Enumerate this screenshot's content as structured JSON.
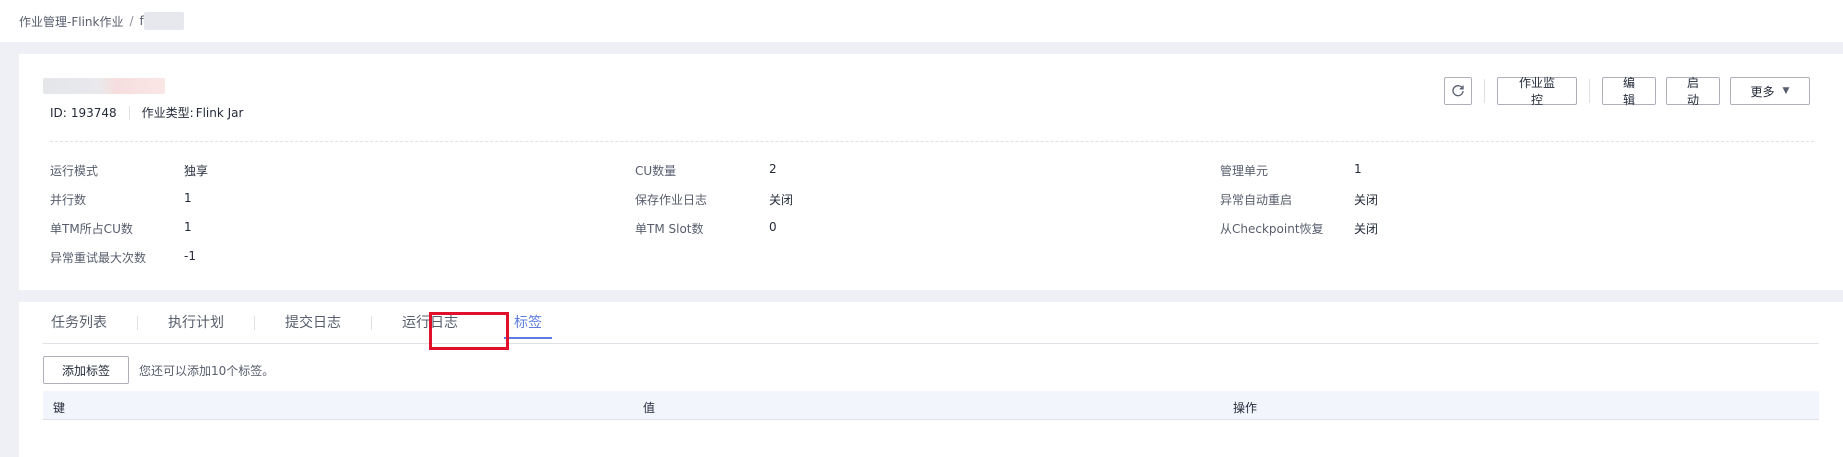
{
  "breadcrumb": {
    "parent": "作业管理-Flink作业",
    "separator": "/",
    "current": "f"
  },
  "job": {
    "id_label": "ID:",
    "id_value": "193748",
    "type_label": "作业类型:",
    "type_value": "Flink Jar"
  },
  "actions": {
    "refresh_icon": "refresh-icon",
    "monitor": "作业监控",
    "edit": "编辑",
    "start": "启动",
    "more": "更多"
  },
  "info": {
    "rows": [
      [
        {
          "key": "运行模式",
          "value": "独享"
        },
        {
          "key": "CU数量",
          "value": "2"
        },
        {
          "key": "管理单元",
          "value": "1"
        }
      ],
      [
        {
          "key": "并行数",
          "value": "1"
        },
        {
          "key": "保存作业日志",
          "value": "关闭"
        },
        {
          "key": "异常自动重启",
          "value": "关闭"
        }
      ],
      [
        {
          "key": "单TM所占CU数",
          "value": "1"
        },
        {
          "key": "单TM Slot数",
          "value": "0"
        },
        {
          "key": "从Checkpoint恢复",
          "value": "关闭"
        }
      ],
      [
        {
          "key": "异常重试最大次数",
          "value": "-1"
        }
      ]
    ]
  },
  "tabs": [
    {
      "label": "任务列表"
    },
    {
      "label": "执行计划"
    },
    {
      "label": "提交日志"
    },
    {
      "label": "运行日志"
    },
    {
      "label": "标签"
    }
  ],
  "tags": {
    "add_button": "添加标签",
    "hint": "您还可以添加10个标签。",
    "columns": [
      "键",
      "值",
      "操作"
    ]
  },
  "colors": {
    "accent": "#5e7ce0",
    "highlight": "#e0102b"
  }
}
